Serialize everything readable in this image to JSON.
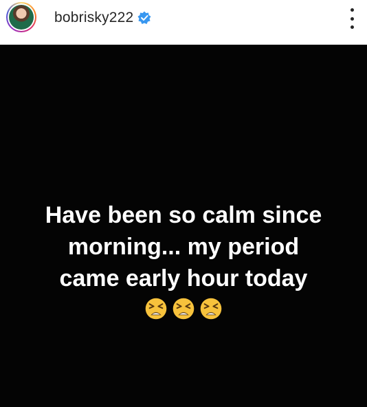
{
  "header": {
    "username": "bobrisky222",
    "verified": true
  },
  "post": {
    "lines": [
      "Have been so calm since",
      "morning... my period",
      "came early hour today"
    ],
    "emoji_icons": [
      "tired-face-icon",
      "tired-face-icon",
      "tired-face-icon"
    ]
  },
  "colors": {
    "post_background": "#040404",
    "verified_blue": "#3897f0",
    "emoji_yellow": "#f7c23c"
  }
}
